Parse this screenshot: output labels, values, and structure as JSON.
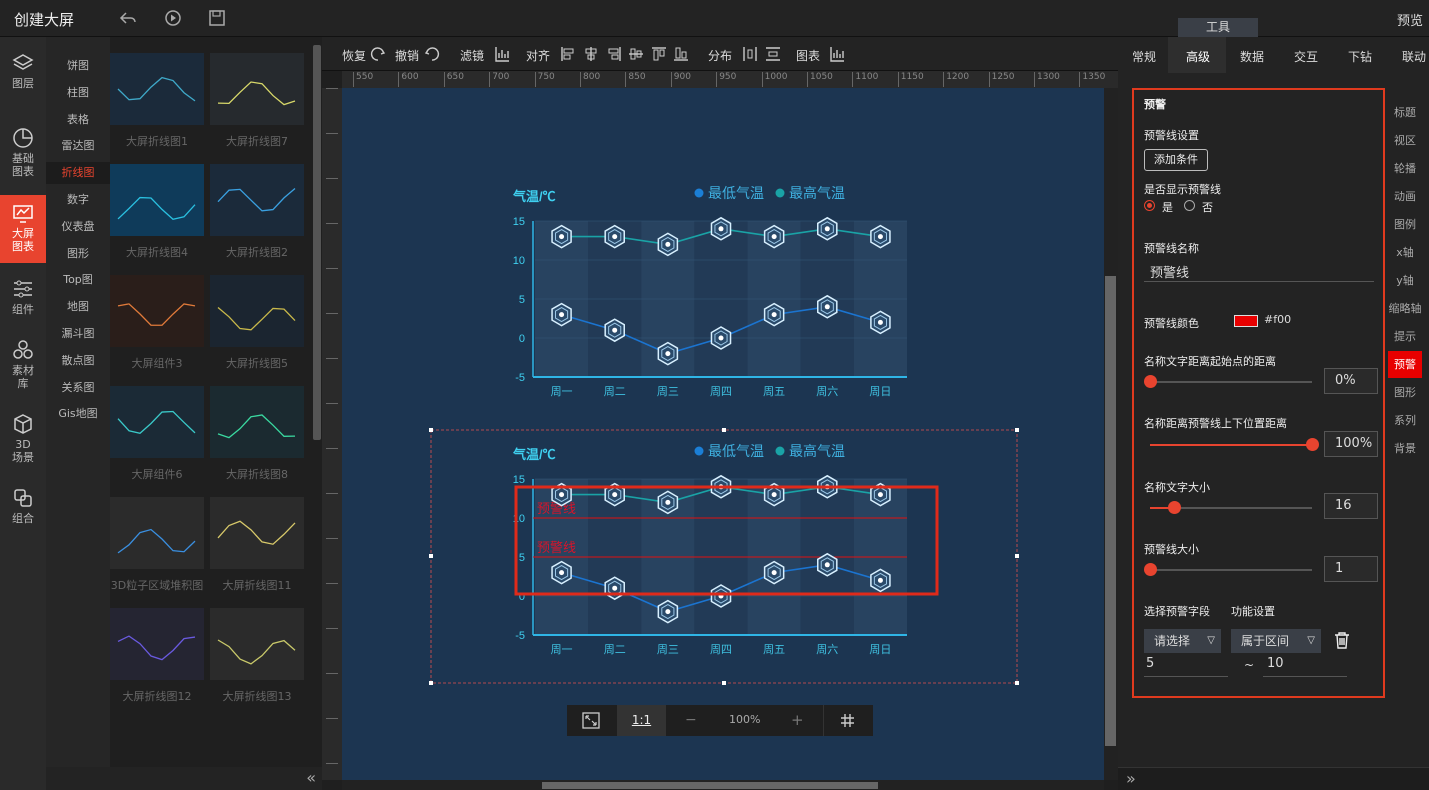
{
  "app": {
    "title": "创建大屏",
    "tools_tab": "工具",
    "preview": "预览"
  },
  "leftnav": [
    {
      "label": "图层",
      "icon": "layers-icon"
    },
    {
      "label": "基础图表",
      "icon": "pie-clock-icon"
    },
    {
      "label": "大屏图表",
      "icon": "screen-chart-icon"
    },
    {
      "label": "组件",
      "icon": "sliders-icon"
    },
    {
      "label": "素材库",
      "icon": "circles-icon"
    },
    {
      "label": "3D场景",
      "icon": "cube-icon"
    },
    {
      "label": "组合",
      "icon": "combine-icon"
    }
  ],
  "categories": [
    "饼图",
    "柱图",
    "表格",
    "雷达图",
    "折线图",
    "数字",
    "仪表盘",
    "图形",
    "Top图",
    "地图",
    "漏斗图",
    "散点图",
    "关系图",
    "Gis地图"
  ],
  "thumbs": [
    {
      "label": "大屏折线图1"
    },
    {
      "label": "大屏折线图7"
    },
    {
      "label": "大屏折线图4"
    },
    {
      "label": "大屏折线图2"
    },
    {
      "label": "大屏组件3"
    },
    {
      "label": "大屏折线图5"
    },
    {
      "label": "大屏组件6"
    },
    {
      "label": "大屏折线图8"
    },
    {
      "label": "3D粒子区域堆积图"
    },
    {
      "label": "大屏折线图11"
    },
    {
      "label": "大屏折线图12"
    },
    {
      "label": "大屏折线图13"
    }
  ],
  "toolbar": {
    "redo": "恢复",
    "undo": "撤销",
    "filter": "滤镜",
    "align": "对齐",
    "distribute": "分布",
    "chart": "图表"
  },
  "ruler_h": [
    "550",
    "600",
    "650",
    "700",
    "750",
    "800",
    "850",
    "900",
    "950",
    "1000",
    "1050",
    "1100",
    "1150",
    "1200",
    "1250",
    "1300",
    "1350"
  ],
  "zoom": {
    "ratio": "1:1",
    "minus": "−",
    "value": "100%",
    "plus": "+"
  },
  "chart1": {
    "ylabel": "气温/℃",
    "legend": [
      "最低气温",
      "最高气温"
    ],
    "colors": {
      "low": "#1b7fd6",
      "high": "#1aa3a6"
    }
  },
  "chart2": {
    "ylabel": "气温/℃",
    "legend": [
      "最低气温",
      "最高气温"
    ],
    "warning_label": "预警线"
  },
  "chart_data": [
    {
      "type": "line",
      "ylabel": "气温/℃",
      "categories": [
        "周一",
        "周二",
        "周三",
        "周四",
        "周五",
        "周六",
        "周日"
      ],
      "ylim": [
        -5,
        15
      ],
      "yticks": [
        "15",
        "10",
        "5",
        "0",
        "-5"
      ],
      "series": [
        {
          "name": "最低气温",
          "values": [
            3,
            1,
            -2,
            0,
            3,
            4,
            2
          ]
        },
        {
          "name": "最高气温",
          "values": [
            13,
            13,
            12,
            14,
            13,
            14,
            13
          ]
        }
      ]
    },
    {
      "type": "line",
      "ylabel": "气温/℃",
      "categories": [
        "周一",
        "周二",
        "周三",
        "周四",
        "周五",
        "周六",
        "周日"
      ],
      "ylim": [
        -5,
        15
      ],
      "yticks": [
        "15",
        "10",
        "5",
        "0",
        "-5"
      ],
      "series": [
        {
          "name": "最低气温",
          "values": [
            3,
            1,
            -2,
            0,
            3,
            4,
            2
          ]
        },
        {
          "name": "最高气温",
          "values": [
            13,
            13,
            12,
            14,
            13,
            14,
            13
          ]
        }
      ],
      "warning_lines": [
        {
          "label": "预警线",
          "value": 10
        },
        {
          "label": "预警线",
          "value": 5
        }
      ]
    }
  ],
  "rpanel": {
    "tabs": [
      "常规",
      "高级",
      "数据",
      "交互",
      "下钻",
      "联动"
    ],
    "section": "预警",
    "setting_title": "预警线设置",
    "add_condition": "添加条件",
    "show_label": "是否显示预警线",
    "yes": "是",
    "no": "否",
    "name_label": "预警线名称",
    "name_value": "预警线",
    "color_label": "预警线颜色",
    "color_value": "#f00",
    "dist_label": "名称文字距离起始点的距离",
    "dist_value": "0%",
    "dist_level": 0,
    "vdist_label": "名称距离预警线上下位置距离",
    "vdist_value": "100%",
    "vdist_level": 1,
    "fontsize_label": "名称文字大小",
    "fontsize_value": "16",
    "fontsize_level": 0.15,
    "linesize_label": "预警线大小",
    "linesize_value": "1",
    "linesize_level": 0,
    "field_label": "选择预警字段",
    "func_label": "功能设置",
    "field_select": "请选择",
    "func_select": "属于区间",
    "range_from": "5",
    "range_sep": "~",
    "range_to": "10"
  },
  "sidetabs": [
    "标题",
    "视区",
    "轮播",
    "动画",
    "图例",
    "x轴",
    "y轴",
    "缩略轴",
    "提示",
    "预警",
    "图形",
    "系列",
    "背景"
  ]
}
